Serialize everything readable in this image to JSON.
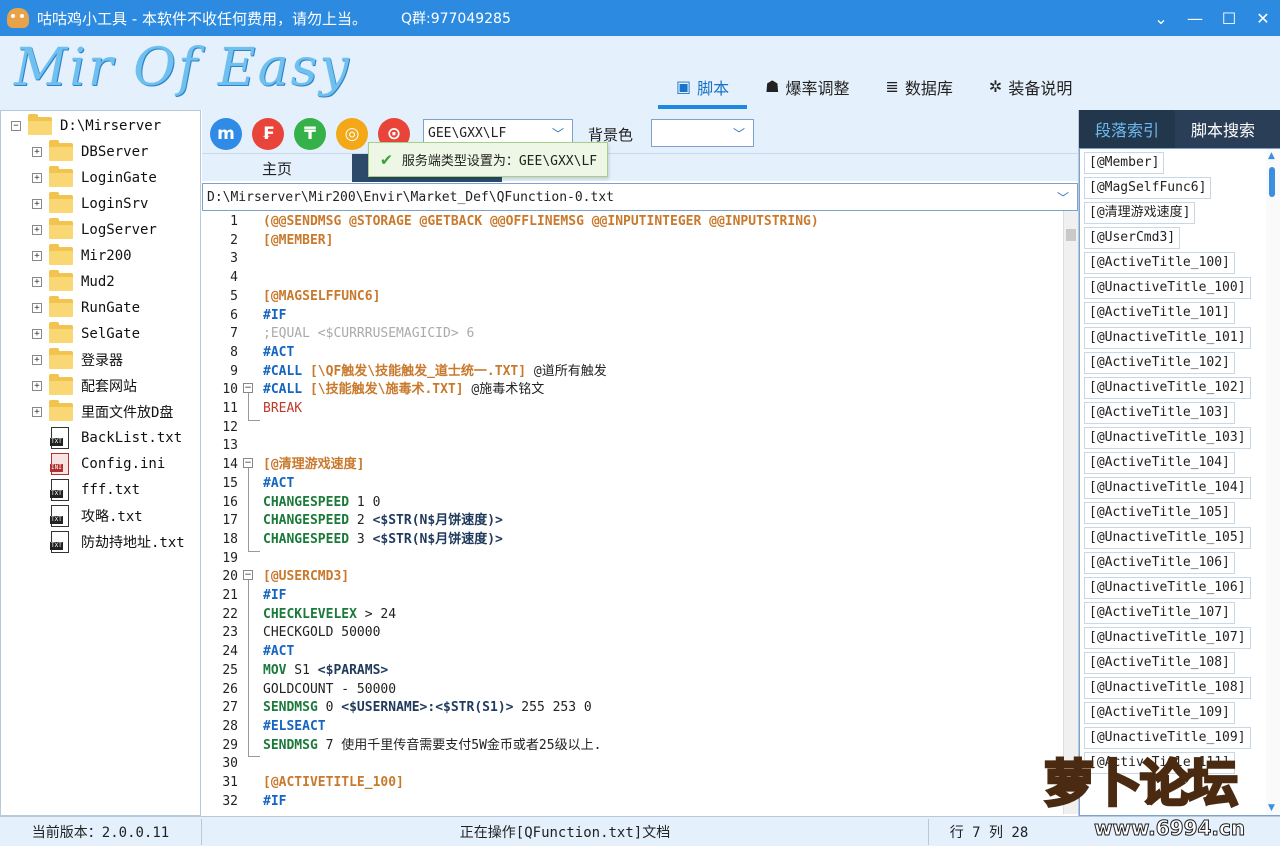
{
  "window": {
    "title": "咕咕鸡小工具 - 本软件不收任何费用，请勿上当。",
    "qq": "Q群:977049285",
    "min_icon": "minimize-icon",
    "max_icon": "maximize-icon",
    "close_icon": "close-icon",
    "dropdown_icon": "chevron-down-icon"
  },
  "header": {
    "logo": "Mir Of Easy",
    "tabs": [
      {
        "label": "脚本",
        "icon": "script-icon",
        "active": true
      },
      {
        "label": "爆率调整",
        "icon": "drop-rate-icon",
        "active": false
      },
      {
        "label": "数据库",
        "icon": "database-icon",
        "active": false
      },
      {
        "label": "装备说明",
        "icon": "equipment-icon",
        "active": false
      }
    ]
  },
  "tree": {
    "root": "D:\\Mirserver",
    "folders": [
      "DBServer",
      "LoginGate",
      "LoginSrv",
      "LogServer",
      "Mir200",
      "Mud2",
      "RunGate",
      "SelGate",
      "登录器",
      "配套网站",
      "里面文件放D盘"
    ],
    "files": [
      {
        "name": "BackList.txt",
        "type": "txt"
      },
      {
        "name": "Config.ini",
        "type": "ini"
      },
      {
        "name": "fff.txt",
        "type": "txt"
      },
      {
        "name": "攻略.txt",
        "type": "txt"
      },
      {
        "name": "防劫持地址.txt",
        "type": "txt"
      }
    ]
  },
  "toolbar": {
    "buttons": [
      {
        "icon": "m-icon",
        "glyph": "m",
        "color": "#2f8be6"
      },
      {
        "icon": "f-icon",
        "glyph": "₣",
        "color": "#e8443a"
      },
      {
        "icon": "t-icon",
        "glyph": "₸",
        "color": "#35b14a"
      },
      {
        "icon": "coin-icon",
        "glyph": "◎",
        "color": "#f2a817"
      },
      {
        "icon": "compass-icon",
        "glyph": "⊙",
        "color": "#e8443a"
      }
    ],
    "server_type": "GEE\\GXX\\LF",
    "bg_label": "背景色",
    "bg_value": ""
  },
  "doc": {
    "tab_home": "主页",
    "tooltip": "服务端类型设置为：GEE\\GXX\\LF",
    "path": "D:\\Mirserver\\Mir200\\Envir\\Market_Def\\QFunction-0.txt"
  },
  "code": [
    {
      "n": "1",
      "segs": [
        [
          "label",
          "(@@SENDMSG @STORAGE @GETBACK @@OFFLINEMSG @@INPUTINTEGER @@INPUTSTRING)"
        ]
      ]
    },
    {
      "n": "2",
      "segs": [
        [
          "label",
          "[@MEMBER]"
        ]
      ]
    },
    {
      "n": "3",
      "segs": []
    },
    {
      "n": "4",
      "segs": []
    },
    {
      "n": "5",
      "segs": [
        [
          "label",
          "[@MAGSELFFUNC6]"
        ]
      ]
    },
    {
      "n": "6",
      "segs": [
        [
          "kw",
          "#IF"
        ]
      ]
    },
    {
      "n": "7",
      "segs": [
        [
          "cmt",
          ";EQUAL <$CURRRUSEMAGICID> 6"
        ]
      ]
    },
    {
      "n": "8",
      "segs": [
        [
          "kw",
          "#ACT"
        ]
      ]
    },
    {
      "n": "9",
      "segs": [
        [
          "kw",
          "#CALL "
        ],
        [
          "label",
          "[\\QF触发\\技能触发_道士统一.TXT]"
        ],
        [
          "plain",
          " @道所有触发"
        ]
      ]
    },
    {
      "n": "10",
      "segs": [
        [
          "kw",
          "#CALL "
        ],
        [
          "label",
          "[\\技能触发\\施毒术.TXT]"
        ],
        [
          "plain",
          " @施毒术铭文"
        ]
      ]
    },
    {
      "n": "11",
      "segs": [
        [
          "red",
          "BREAK"
        ]
      ]
    },
    {
      "n": "12",
      "segs": []
    },
    {
      "n": "13",
      "segs": []
    },
    {
      "n": "14",
      "segs": [
        [
          "label",
          "[@清理游戏速度]"
        ]
      ]
    },
    {
      "n": "15",
      "segs": [
        [
          "kw",
          "#ACT"
        ]
      ]
    },
    {
      "n": "16",
      "segs": [
        [
          "cmd",
          "CHANGESPEED"
        ],
        [
          "plain",
          " 1 0"
        ]
      ]
    },
    {
      "n": "17",
      "segs": [
        [
          "cmd",
          "CHANGESPEED"
        ],
        [
          "plain",
          " 2 "
        ],
        [
          "var",
          "<$STR(N$月饼速度)>"
        ]
      ]
    },
    {
      "n": "18",
      "segs": [
        [
          "cmd",
          "CHANGESPEED"
        ],
        [
          "plain",
          " 3 "
        ],
        [
          "var",
          "<$STR(N$月饼速度)>"
        ]
      ]
    },
    {
      "n": "19",
      "segs": []
    },
    {
      "n": "20",
      "segs": [
        [
          "label",
          "[@USERCMD3]"
        ]
      ]
    },
    {
      "n": "21",
      "segs": [
        [
          "kw",
          "#IF"
        ]
      ]
    },
    {
      "n": "22",
      "segs": [
        [
          "cmd",
          "CHECKLEVELEX"
        ],
        [
          "plain",
          " > 24"
        ]
      ]
    },
    {
      "n": "23",
      "segs": [
        [
          "plain",
          "CHECKGOLD 50000"
        ]
      ]
    },
    {
      "n": "24",
      "segs": [
        [
          "kw",
          "#ACT"
        ]
      ]
    },
    {
      "n": "25",
      "segs": [
        [
          "cmd",
          "MOV"
        ],
        [
          "plain",
          " S1 "
        ],
        [
          "var",
          "<$PARAMS>"
        ]
      ]
    },
    {
      "n": "26",
      "segs": [
        [
          "plain",
          "GOLDCOUNT - 50000"
        ]
      ]
    },
    {
      "n": "27",
      "segs": [
        [
          "cmd",
          "SENDMSG"
        ],
        [
          "plain",
          " 0 "
        ],
        [
          "var",
          "<$USERNAME>:<$STR(S1)>"
        ],
        [
          "plain",
          " 255 253 0"
        ]
      ]
    },
    {
      "n": "28",
      "segs": [
        [
          "kw",
          "#ELSEACT"
        ]
      ]
    },
    {
      "n": "29",
      "segs": [
        [
          "cmd",
          "SENDMSG"
        ],
        [
          "plain",
          " 7 使用千里传音需要支付5W金币或者25级以上."
        ]
      ]
    },
    {
      "n": "30",
      "segs": []
    },
    {
      "n": "31",
      "segs": [
        [
          "label",
          "[@ACTIVETITLE_100]"
        ]
      ]
    },
    {
      "n": "32",
      "segs": [
        [
          "kw",
          "#IF"
        ]
      ]
    }
  ],
  "right": {
    "tabs": [
      "段落索引",
      "脚本搜索"
    ],
    "index": [
      "[@Member]",
      "[@MagSelfFunc6]",
      "[@清理游戏速度]",
      "[@UserCmd3]",
      "[@ActiveTitle_100]",
      "[@UnactiveTitle_100]",
      "[@ActiveTitle_101]",
      "[@UnactiveTitle_101]",
      "[@ActiveTitle_102]",
      "[@UnactiveTitle_102]",
      "[@ActiveTitle_103]",
      "[@UnactiveTitle_103]",
      "[@ActiveTitle_104]",
      "[@UnactiveTitle_104]",
      "[@ActiveTitle_105]",
      "[@UnactiveTitle_105]",
      "[@ActiveTitle_106]",
      "[@UnactiveTitle_106]",
      "[@ActiveTitle_107]",
      "[@UnactiveTitle_107]",
      "[@ActiveTitle_108]",
      "[@UnactiveTitle_108]",
      "[@ActiveTitle_109]",
      "[@UnactiveTitle_109]",
      "[@ActiveTitle_111]"
    ]
  },
  "status": {
    "version": "当前版本：2.0.0.11",
    "operation": "正在操作[QFunction.txt]文档",
    "position": "行 7 列 28"
  },
  "watermark": {
    "text": "萝卜论坛",
    "url": "www.6994.cn"
  }
}
